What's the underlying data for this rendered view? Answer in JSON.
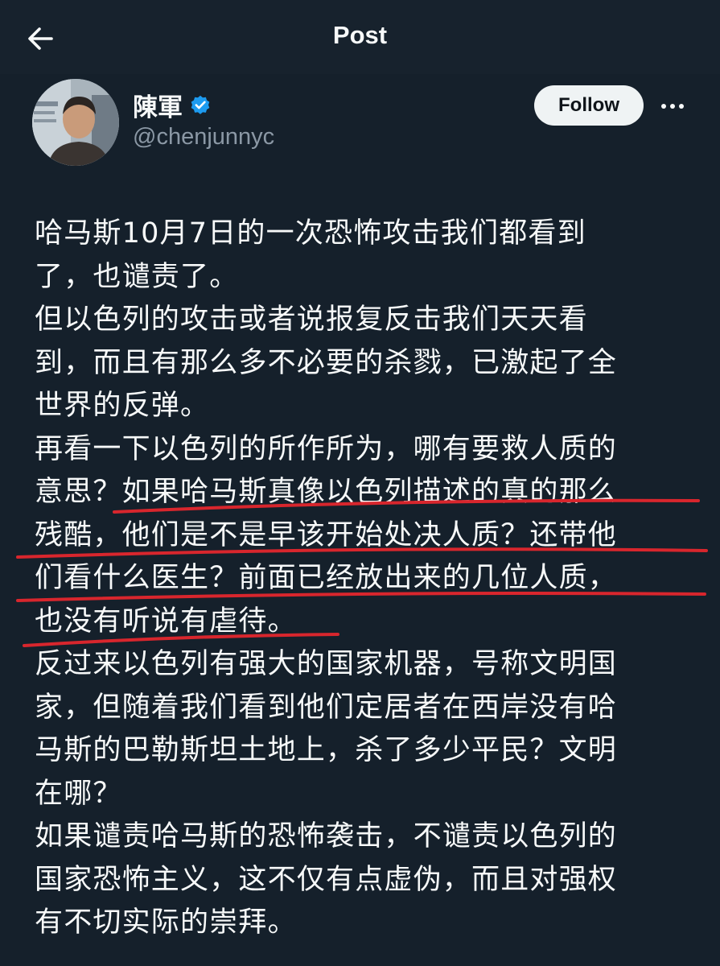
{
  "header": {
    "title": "Post",
    "back_icon": "arrow-left-icon"
  },
  "author": {
    "display_name": "陳軍",
    "handle": "@chenjunnyc",
    "verified": true,
    "verified_color": "#1d9bf0"
  },
  "actions": {
    "follow_label": "Follow",
    "more_icon": "more-horizontal-icon"
  },
  "post": {
    "lines": [
      "哈马斯10月7日的一次恐怖攻击我们都看到",
      "了，也谴责了。",
      "但以色列的攻击或者说报复反击我们天天看",
      "到，而且有那么多不必要的杀戮，已激起了全",
      "世界的反弹。",
      "再看一下以色列的所作所为，哪有要救人质的",
      "意思？如果哈马斯真像以色列描述的真的那么",
      "残酷，他们是不是早该开始处决人质？还带他",
      "们看什么医生？前面已经放出来的几位人质，",
      "也没有听说有虐待。",
      "反过来以色列有强大的国家机器，号称文明国",
      "家，但随着我们看到他们定居者在西岸没有哈",
      "马斯的巴勒斯坦土地上，杀了多少平民？文明",
      "在哪？",
      "如果谴责哈马斯的恐怖袭击，不谴责以色列的",
      "国家恐怖主义，这不仅有点虚伪，而且对强权",
      "有不切实际的崇拜。"
    ]
  },
  "annotations": {
    "underline_color": "#d8262d",
    "underlined_lines": [
      6,
      7,
      8,
      9
    ]
  },
  "colors": {
    "background": "#15202b",
    "text": "#f7f9f9",
    "secondary_text": "#8b98a5",
    "follow_button_bg": "#eff3f4"
  }
}
